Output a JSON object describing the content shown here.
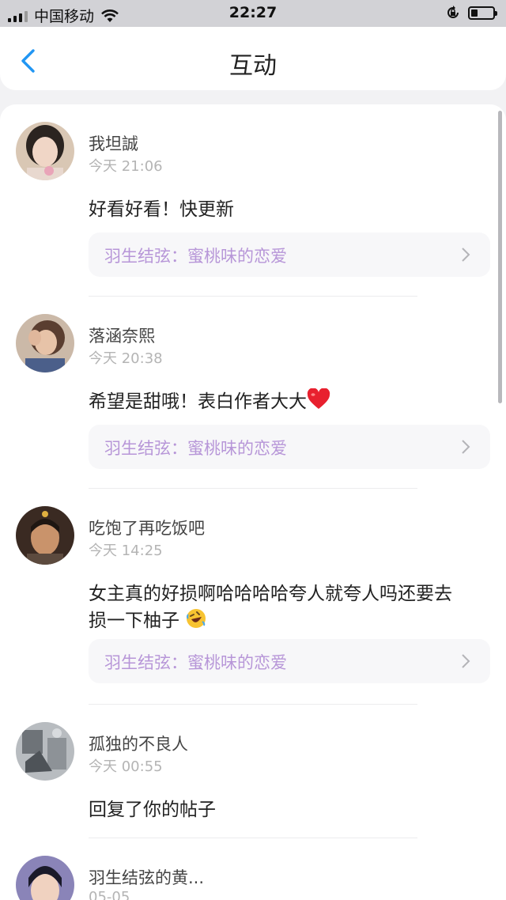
{
  "status_bar": {
    "carrier": "中国移动",
    "time": "22:27"
  },
  "nav": {
    "title": "互动",
    "back_icon": "chevron-left-icon"
  },
  "colors": {
    "accent": "#2196F3",
    "source_link": "#B796D8"
  },
  "items": [
    {
      "name": "我坦誠",
      "time": "今天 21:06",
      "content": "好看好看！快更新",
      "source": "羽生结弦：蜜桃味的恋爱"
    },
    {
      "name": "落涵奈熙",
      "time": "今天 20:38",
      "content": "希望是甜哦！表白作者大大",
      "emoji": "heart",
      "source": "羽生结弦：蜜桃味的恋爱"
    },
    {
      "name": "吃饱了再吃饭吧",
      "time": "今天 14:25",
      "content_line1": "女主真的好损啊哈哈哈哈夸人就夸人吗还要去",
      "content_line2": "损一下柚子",
      "emoji": "rolling-on-floor-laughing",
      "source": "羽生结弦：蜜桃味的恋爱"
    },
    {
      "name": "孤独的不良人",
      "time": "今天 00:55",
      "content": "回复了你的帖子"
    },
    {
      "name": "羽生结弦的黄...",
      "time": "05-05"
    }
  ]
}
